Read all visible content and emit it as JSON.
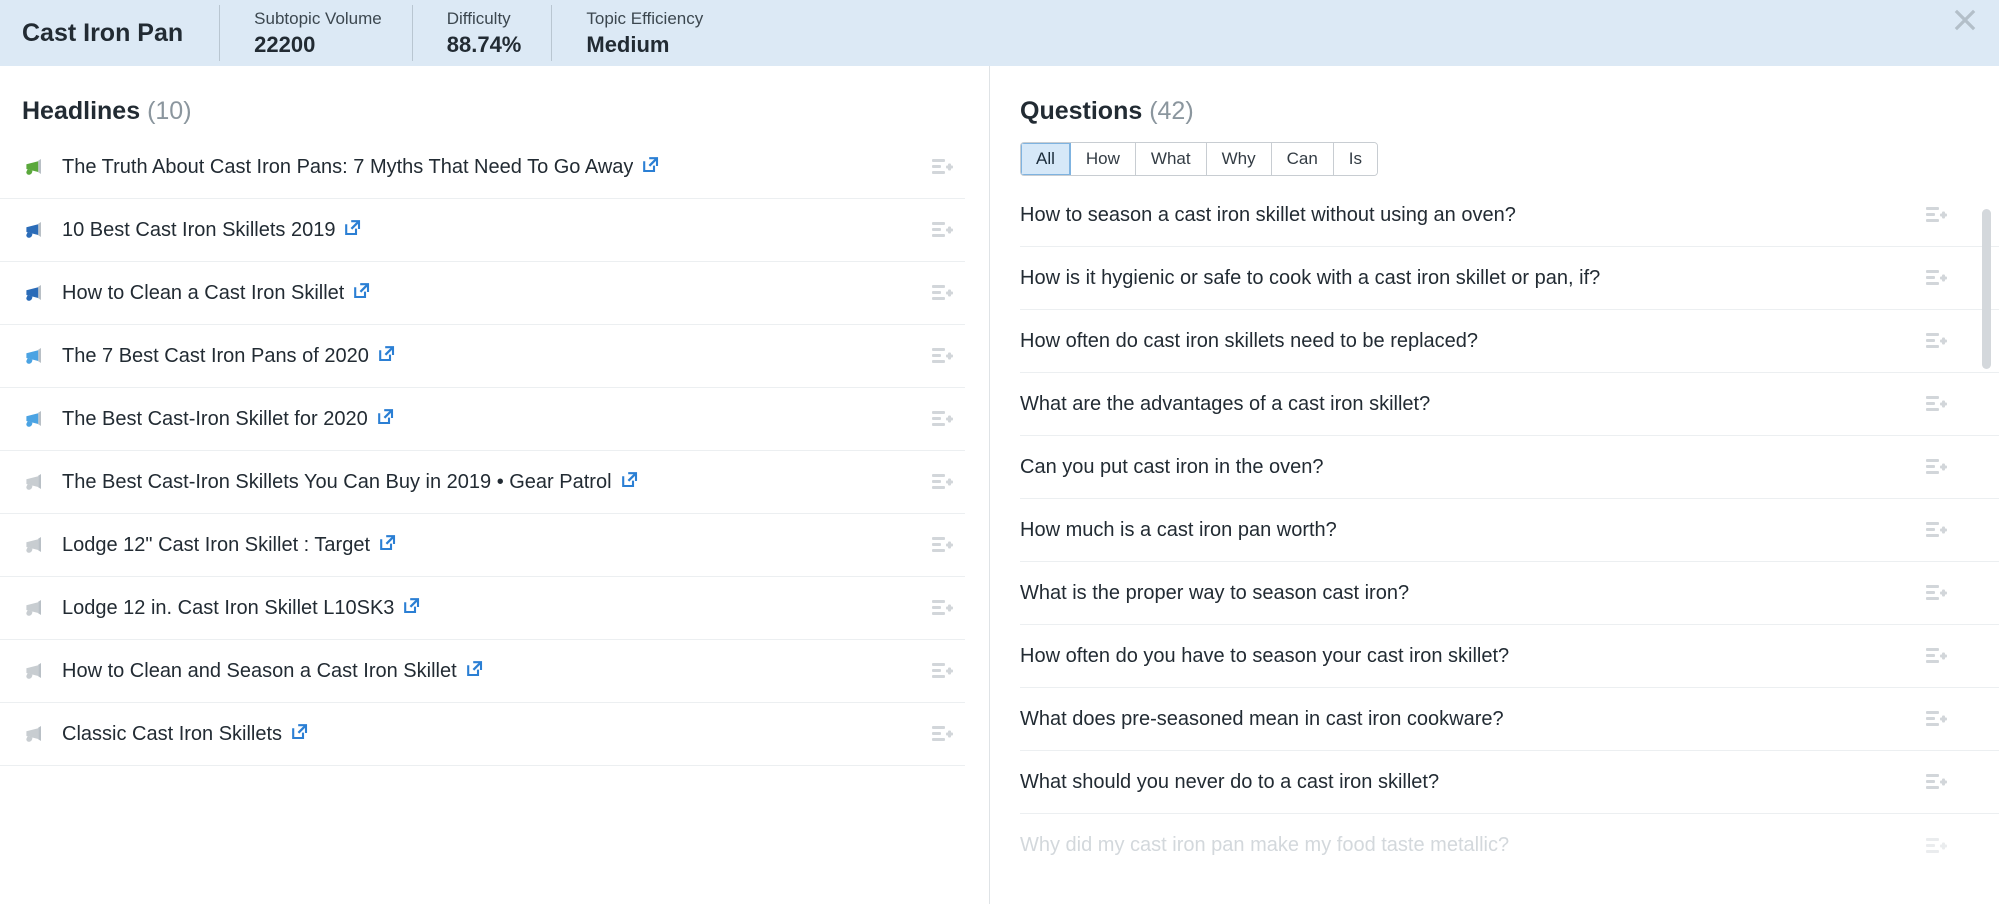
{
  "header": {
    "title": "Cast Iron Pan",
    "metrics": [
      {
        "label": "Subtopic Volume",
        "value": "22200"
      },
      {
        "label": "Difficulty",
        "value": "88.74%"
      },
      {
        "label": "Topic Efficiency",
        "value": "Medium"
      }
    ],
    "close_label": "×"
  },
  "headlines": {
    "title": "Headlines",
    "count": "(10)",
    "items": [
      {
        "text": "The Truth About Cast Iron Pans: 7 Myths That Need To Go Away",
        "icon": "megaphone-icon",
        "icon_color": "#5aa83c"
      },
      {
        "text": "10 Best Cast Iron Skillets 2019",
        "icon": "megaphone-icon",
        "icon_color": "#2b6cb8"
      },
      {
        "text": "How to Clean a Cast Iron Skillet",
        "icon": "megaphone-icon",
        "icon_color": "#2b6cb8"
      },
      {
        "text": "The 7 Best Cast Iron Pans of 2020",
        "icon": "megaphone-icon",
        "icon_color": "#4ba3e3"
      },
      {
        "text": "The Best Cast-Iron Skillet for 2020",
        "icon": "megaphone-icon",
        "icon_color": "#4ba3e3"
      },
      {
        "text": "The Best Cast-Iron Skillets You Can Buy in 2019 • Gear Patrol",
        "icon": "megaphone-icon",
        "icon_color": "#c8cdd1"
      },
      {
        "text": "Lodge 12\" Cast Iron Skillet : Target",
        "icon": "megaphone-icon",
        "icon_color": "#c8cdd1"
      },
      {
        "text": "Lodge 12 in. Cast Iron Skillet L10SK3",
        "icon": "megaphone-icon",
        "icon_color": "#c8cdd1"
      },
      {
        "text": "How to Clean and Season a Cast Iron Skillet",
        "icon": "megaphone-icon",
        "icon_color": "#c8cdd1"
      },
      {
        "text": "Classic Cast Iron Skillets",
        "icon": "megaphone-icon",
        "icon_color": "#c8cdd1"
      }
    ]
  },
  "questions": {
    "title": "Questions",
    "count": "(42)",
    "tabs": [
      {
        "label": "All",
        "active": true
      },
      {
        "label": "How",
        "active": false
      },
      {
        "label": "What",
        "active": false
      },
      {
        "label": "Why",
        "active": false
      },
      {
        "label": "Can",
        "active": false
      },
      {
        "label": "Is",
        "active": false
      }
    ],
    "items": [
      {
        "text": "How to season a cast iron skillet without using an oven?",
        "faded": false
      },
      {
        "text": "How is it hygienic or safe to cook with a cast iron skillet or pan, if?",
        "faded": false
      },
      {
        "text": "How often do cast iron skillets need to be replaced?",
        "faded": false
      },
      {
        "text": "What are the advantages of a cast iron skillet?",
        "faded": false
      },
      {
        "text": "Can you put cast iron in the oven?",
        "faded": false
      },
      {
        "text": "How much is a cast iron pan worth?",
        "faded": false
      },
      {
        "text": "What is the proper way to season cast iron?",
        "faded": false
      },
      {
        "text": "How often do you have to season your cast iron skillet?",
        "faded": false
      },
      {
        "text": "What does pre-seasoned mean in cast iron cookware?",
        "faded": false
      },
      {
        "text": "What should you never do to a cast iron skillet?",
        "faded": false
      },
      {
        "text": "Why did my cast iron pan make my food taste metallic?",
        "faded": true
      }
    ]
  },
  "colors": {
    "header_bg": "#dce9f5",
    "accent_blue": "#2b7fd4",
    "tab_active_bg": "#d6e8f8",
    "text_dark": "#222b33",
    "text_muted": "#8b969e"
  }
}
